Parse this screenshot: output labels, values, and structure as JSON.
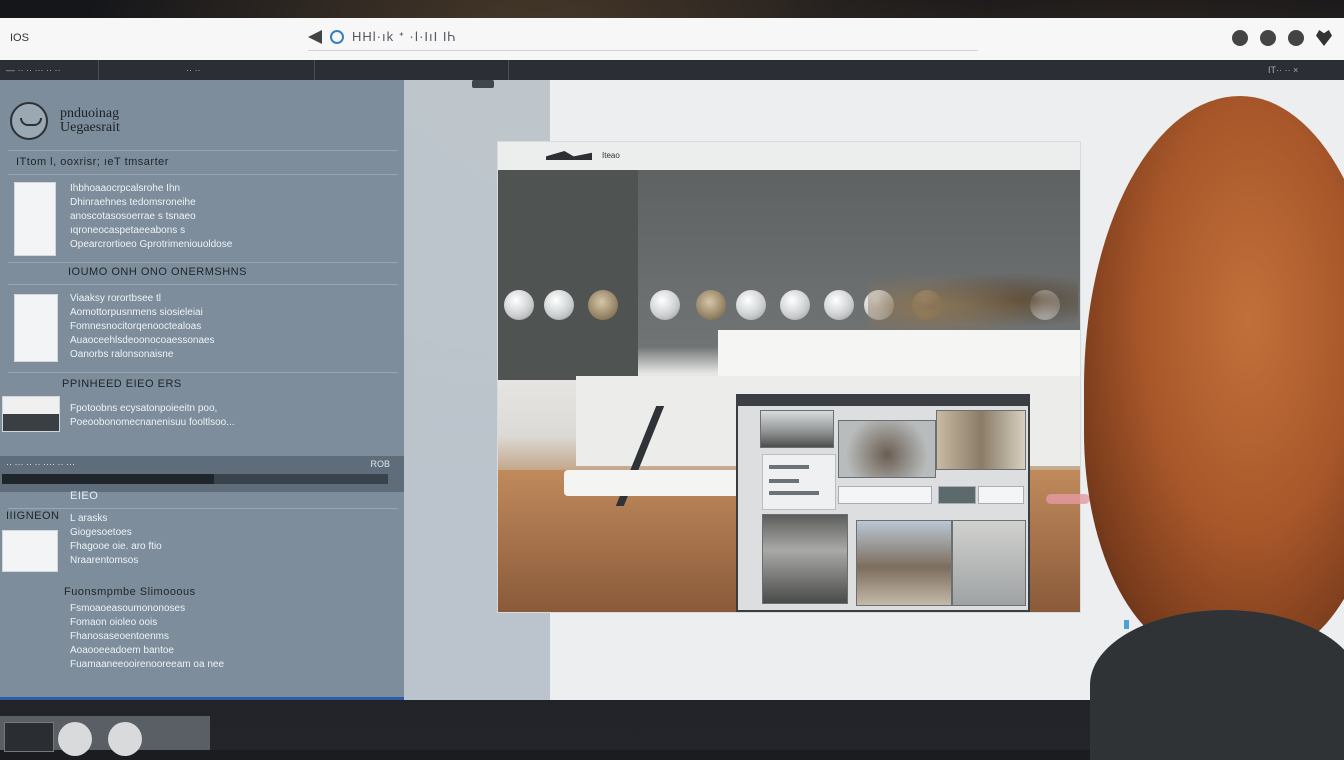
{
  "app": {
    "label": "IOS"
  },
  "address_bar": {
    "text": "HHl·ık ᐩ ·ǀ·IıI ΙᏂ"
  },
  "toolbar": {
    "left_text": "—  ··  ·· ··· ·· ··",
    "center_text": "·· ··",
    "right_text": "IT·· ·· ×"
  },
  "sidebar": {
    "profile_name_line1": "pnduoinag",
    "profile_name_line2": "Uegaesrait",
    "sections": [
      {
        "title": "ITtom l, ooxrisr; ıeT tmsarter",
        "lines": [
          "Ihbhoaaocrpcalsrohe Ihn",
          "Dhinraehnes tedomsroneihe",
          "anoscotasosoerrae s tsnaeo",
          "ıqroneocaspetaeeabons s",
          "Opearcrortioeo Gprotrimeniouoldose"
        ]
      },
      {
        "title": "IOUMO ONH ONO ONERMSHNS",
        "lines": [
          "Viaaksy rorortbsee tl",
          "Aomottorpusnmens siosieleiai",
          "Fomnesnocitorqenooctealoas",
          "Auaoceehlsdeoonocoaessonaes",
          "Oanorbs ralonsonaisne"
        ]
      },
      {
        "title": "PPINHEED  EIEO  ERS",
        "lines": [
          "Fpotoobns ecysatonpoieeitn poo,",
          "Poeoobonomecnanenisuu fooltlsoo..."
        ]
      }
    ],
    "progress": {
      "label": "··  ···  ·· ·· ···· ··  ···",
      "count": "ROB",
      "value": 0.55
    },
    "lower_title": "EIEO",
    "lower_left_label": "IIIGNEON",
    "lower_lines": [
      "L arasks",
      "Giogesoetoes",
      "Fhagooe oie. aro ftio",
      "Nraarentomsos"
    ],
    "footer_title": "Fuonsmpmbe Slimooous",
    "footer_lines": [
      "Fsmoaoeasoumononoses",
      "Fomaon oioleo oois",
      "Fhanosaseoentoenms",
      "Aoaooeeadoem bantoe",
      "Fuamaaneeooirenooreeam oa nee"
    ]
  },
  "viewer": {
    "header_label": "Iteao"
  },
  "colors": {
    "sidebar_bg": "#7d8d9b",
    "accent_blue": "#2c5ea8",
    "hair": "#b05e2e"
  }
}
